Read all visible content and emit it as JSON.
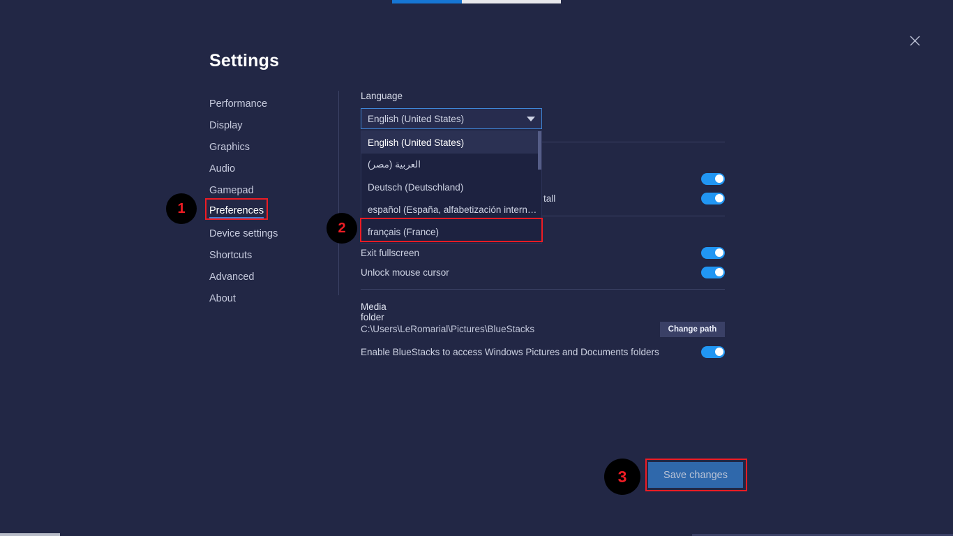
{
  "window": {
    "title": "Settings",
    "close_icon": "close-icon"
  },
  "tabstrip": {
    "active_color": "#1676d4",
    "bar_color": "#e8e8ec"
  },
  "sidebar": {
    "items": [
      {
        "label": "Performance",
        "active": false
      },
      {
        "label": "Display",
        "active": false
      },
      {
        "label": "Graphics",
        "active": false
      },
      {
        "label": "Audio",
        "active": false
      },
      {
        "label": "Gamepad",
        "active": false
      },
      {
        "label": "Preferences",
        "active": true
      },
      {
        "label": "Device settings",
        "active": false
      },
      {
        "label": "Shortcuts",
        "active": false
      },
      {
        "label": "Advanced",
        "active": false
      },
      {
        "label": "About",
        "active": false
      }
    ]
  },
  "content": {
    "language": {
      "label": "Language",
      "selected": "English (United States)",
      "caret_icon": "chevron-down-icon",
      "options": [
        "English (United States)",
        "العربية (مصر)",
        "Deutsch (Deutschland)",
        "español (España, alfabetización intern…",
        "français (France)"
      ],
      "expanded": true
    },
    "toggle_rows": [
      {
        "label": "",
        "value": "on"
      },
      {
        "label": "tall",
        "value": "on"
      },
      {
        "label": "Exit fullscreen",
        "value": "on"
      },
      {
        "label": "Unlock mouse cursor",
        "value": "on"
      }
    ],
    "media": {
      "title": "Media folder",
      "path": "C:\\Users\\LeRomarial\\Pictures\\BlueStacks",
      "change_path_label": "Change path",
      "access_label": "Enable BlueStacks to access Windows Pictures and Documents folders",
      "access_value": "on"
    },
    "save_label": "Save changes"
  },
  "annotations": {
    "markers": [
      {
        "number": "1",
        "target": "Preferences"
      },
      {
        "number": "2",
        "target": "français (France)"
      },
      {
        "number": "3",
        "target": "Save changes"
      }
    ],
    "highlight_color": "#ee1c24"
  },
  "colors": {
    "background": "#222745",
    "accent_blue": "#2196f3",
    "toggle_on": "#2196f3",
    "save_button": "#2f68ab",
    "divider": "#3b4164",
    "annotation_red": "#ee1c24"
  }
}
